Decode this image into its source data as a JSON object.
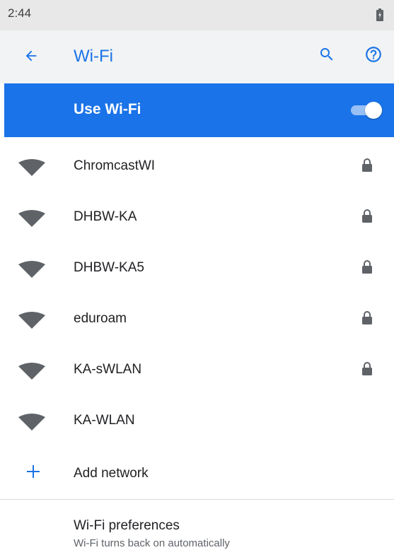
{
  "status_bar": {
    "time": "2:44",
    "battery_icon": "battery-charging-icon"
  },
  "app_bar": {
    "title": "Wi-Fi",
    "back_icon": "arrow-back-icon",
    "search_icon": "search-icon",
    "help_icon": "help-icon",
    "color": "#1a73e8",
    "background": "#f1f3f4"
  },
  "master_switch": {
    "label": "Use Wi-Fi",
    "checked": true,
    "background": "#1a73e8"
  },
  "networks": [
    {
      "ssid": "ChromcastWI",
      "secured": true
    },
    {
      "ssid": "DHBW-KA",
      "secured": true
    },
    {
      "ssid": "DHBW-KA5",
      "secured": true
    },
    {
      "ssid": "eduroam",
      "secured": true
    },
    {
      "ssid": "KA-sWLAN",
      "secured": true
    },
    {
      "ssid": "KA-WLAN",
      "secured": false
    }
  ],
  "add_network": {
    "label": "Add network",
    "icon": "plus-icon"
  },
  "preferences": {
    "title": "Wi-Fi preferences",
    "summary": "Wi-Fi turns back on automatically"
  }
}
